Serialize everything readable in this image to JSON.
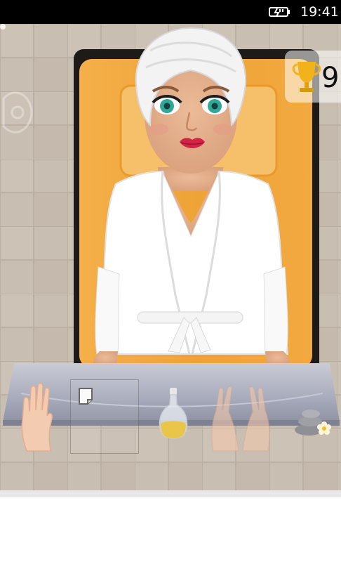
{
  "status_bar": {
    "time": "19:41",
    "icons": [
      "battery-charging-icon"
    ]
  },
  "game": {
    "score": "9",
    "score_icon": "trophy-icon",
    "character": {
      "name": "spa-client",
      "outfit": "white-bathrobe",
      "head": "towel-wrap"
    },
    "tools": [
      {
        "name": "hand-tool",
        "icon": "hand-icon",
        "selected": false
      },
      {
        "name": "sticker-tool",
        "icon": "note-icon",
        "selected": true
      },
      {
        "name": "oil-bottle-tool",
        "icon": "oil-bottle-icon",
        "selected": false
      },
      {
        "name": "massage-hands-tool",
        "icon": "massage-hands-icon",
        "selected": false
      },
      {
        "name": "spa-stones-tool",
        "icon": "spa-stones-icon",
        "selected": false
      }
    ],
    "colors": {
      "tile": "#c9beb2",
      "cushion": "#f0a83a",
      "robe": "#ffffff",
      "skin": "#e6b08d",
      "tray": "#a9acbb"
    }
  }
}
